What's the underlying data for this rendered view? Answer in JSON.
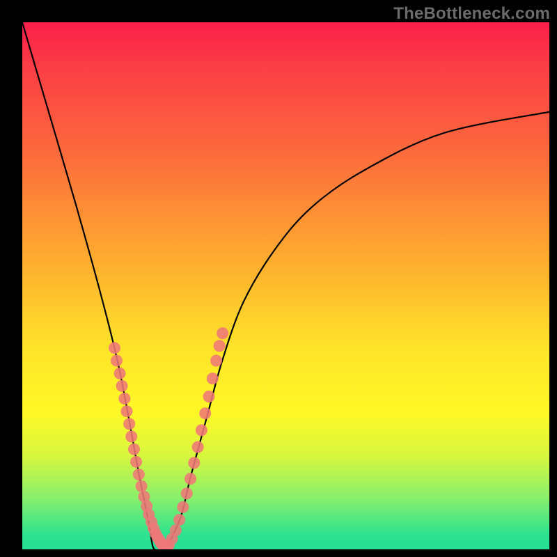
{
  "watermark": "TheBottleneck.com",
  "colors": {
    "frame": "#000000",
    "gradient_top": "#fb1e4a",
    "gradient_mid": "#fee429",
    "gradient_bottom": "#24df96",
    "curve": "#000000",
    "dot": "#ef7878"
  },
  "chart_data": {
    "type": "line",
    "title": "",
    "xlabel": "",
    "ylabel": "",
    "xlim": [
      0,
      100
    ],
    "ylim": [
      0,
      100
    ],
    "series": [
      {
        "name": "bottleneck-curve",
        "x": [
          0,
          5,
          10,
          15,
          18,
          20,
          22,
          24,
          25,
          27,
          30,
          32,
          35,
          38,
          42,
          48,
          55,
          65,
          80,
          100
        ],
        "y": [
          100,
          83,
          66,
          48,
          36,
          26,
          15,
          5,
          0,
          0,
          6,
          14,
          25,
          36,
          47,
          57,
          65,
          72,
          79,
          83
        ]
      }
    ],
    "annotations": {
      "left_arm_dots": {
        "x": [
          17.5,
          17.9,
          18.5,
          18.9,
          19.4,
          19.8,
          20.3,
          20.7,
          21.2,
          21.6,
          22.1,
          22.6,
          23.1,
          23.6,
          24.0,
          24.5,
          24.9,
          25.3,
          25.7,
          26.1,
          26.4,
          26.8,
          27.1,
          27.4
        ],
        "y": [
          38.2,
          35.8,
          33.4,
          31.0,
          28.6,
          26.2,
          23.8,
          21.4,
          19.0,
          16.6,
          14.2,
          12.0,
          10.0,
          8.2,
          6.6,
          5.2,
          4.0,
          3.0,
          2.2,
          1.6,
          1.1,
          0.7,
          0.4,
          0.2
        ]
      },
      "right_arm_dots": {
        "x": [
          27.8,
          28.4,
          29.1,
          29.8,
          30.5,
          31.2,
          31.9,
          32.6,
          33.3,
          34.0,
          34.7,
          35.4,
          36.1,
          36.8,
          37.4,
          38.0
        ],
        "y": [
          0.8,
          2.0,
          3.6,
          5.6,
          8.0,
          10.6,
          13.4,
          16.4,
          19.4,
          22.6,
          25.8,
          29.0,
          32.4,
          35.8,
          38.6,
          41.0
        ]
      }
    }
  }
}
